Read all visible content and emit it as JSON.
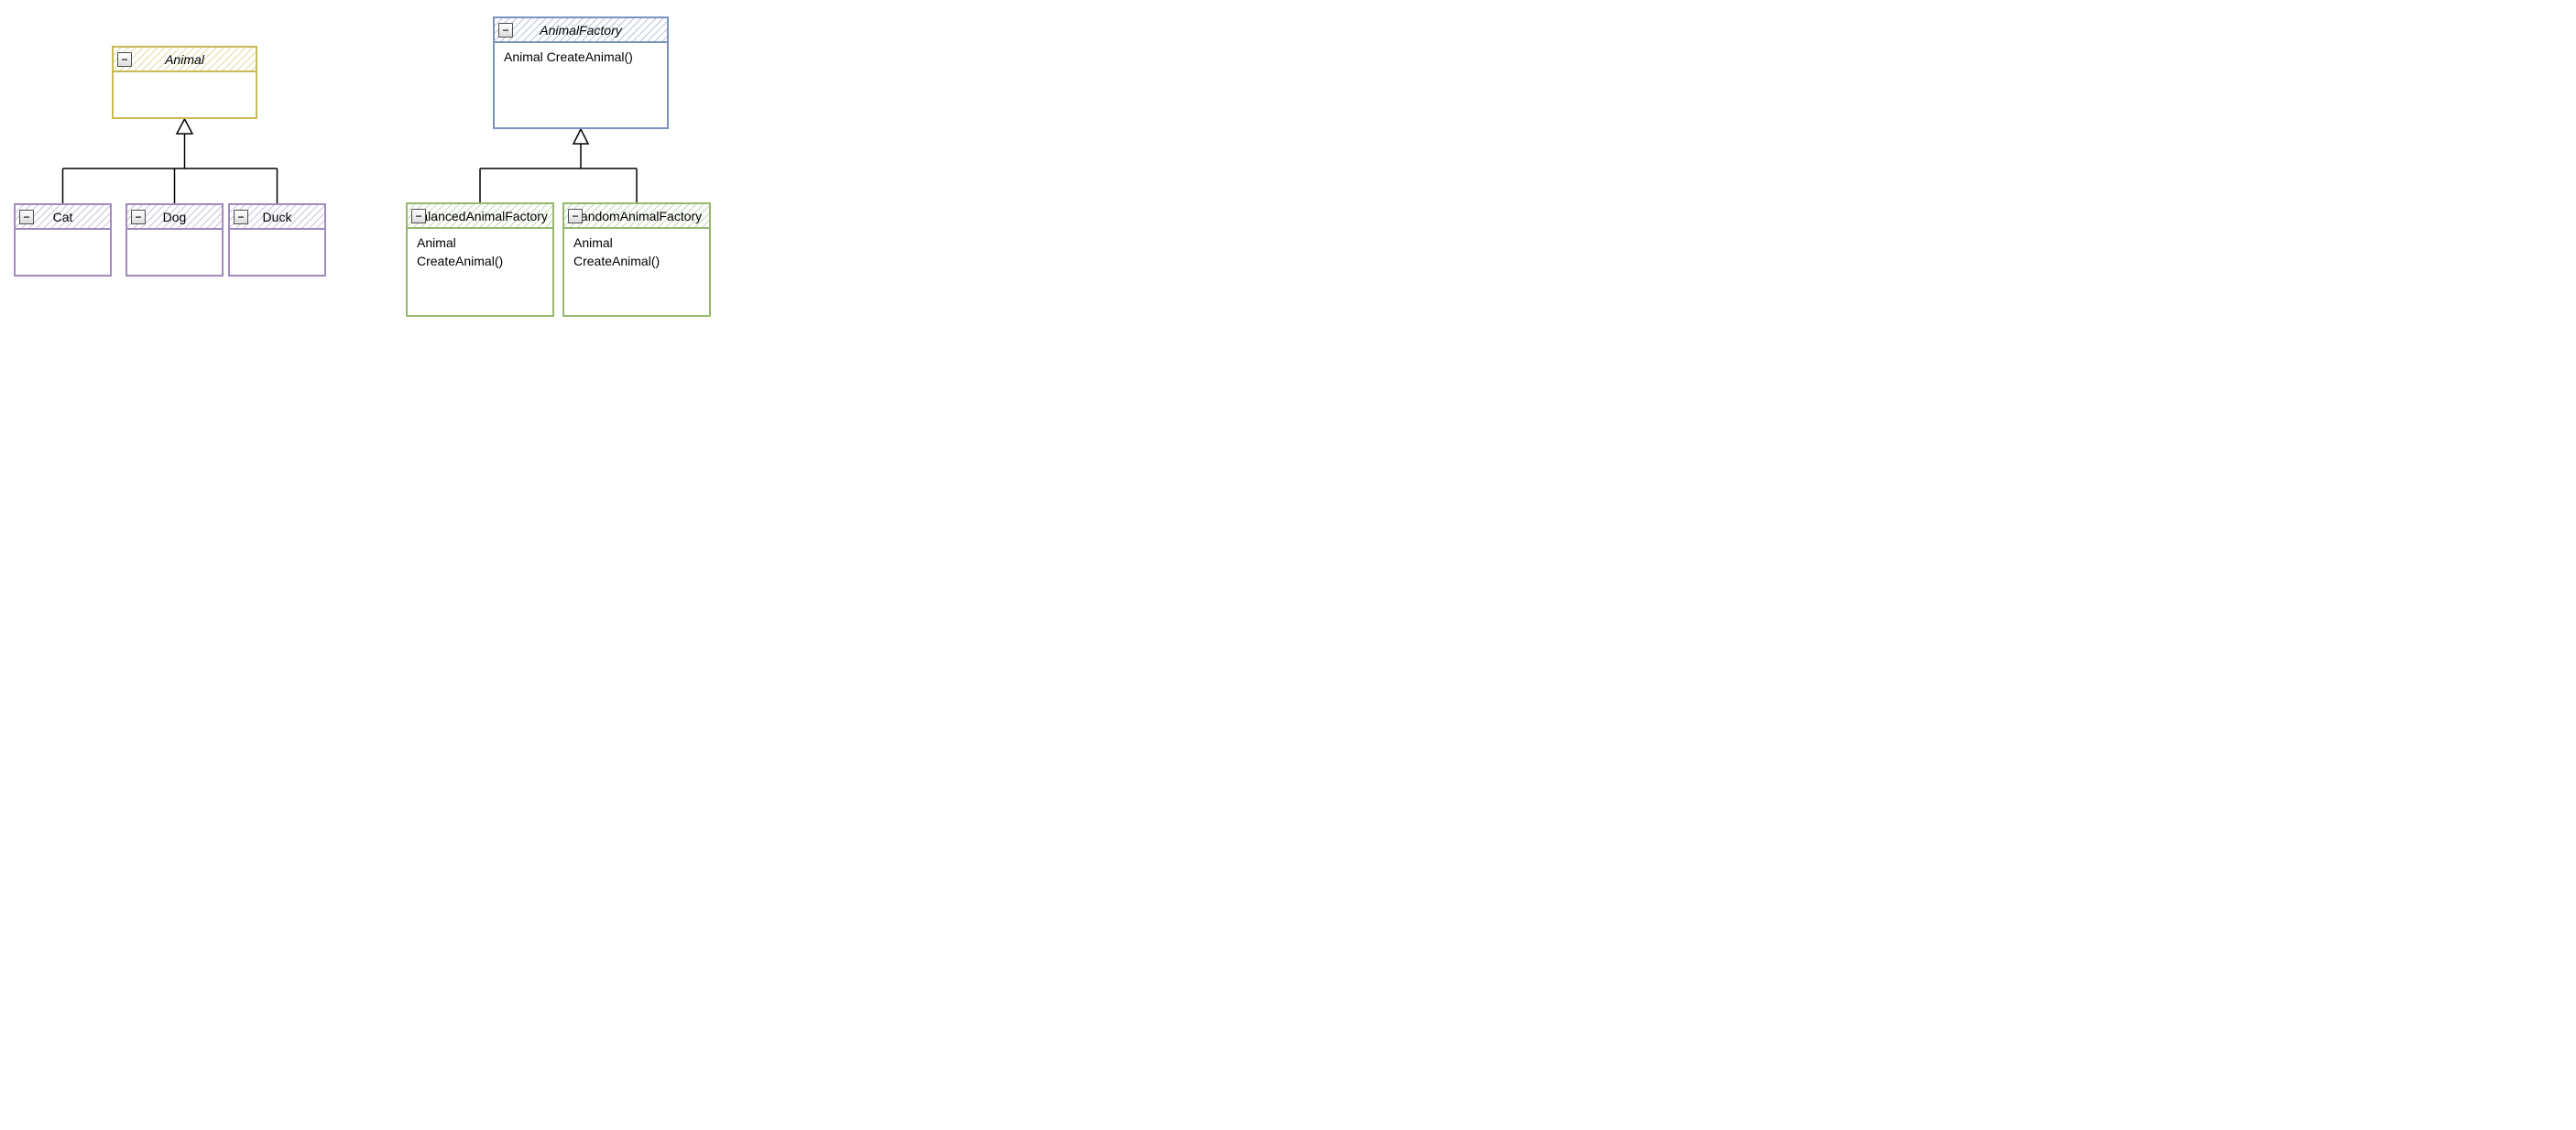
{
  "toggle_glyph": "−",
  "classes": {
    "animal": {
      "name": "Animal",
      "abstract": true,
      "methods": []
    },
    "cat": {
      "name": "Cat",
      "abstract": false,
      "methods": []
    },
    "dog": {
      "name": "Dog",
      "abstract": false,
      "methods": []
    },
    "duck": {
      "name": "Duck",
      "abstract": false,
      "methods": []
    },
    "animalfactory": {
      "name": "AnimalFactory",
      "abstract": true,
      "methods": [
        "Animal CreateAnimal()"
      ]
    },
    "balancedanimalfactory": {
      "name": "BalancedAnimalFactory",
      "abstract": false,
      "methods": [
        "Animal CreateAnimal()"
      ]
    },
    "randomanimalfactory": {
      "name": "RandomAnimalFactory",
      "abstract": false,
      "methods": [
        "Animal CreateAnimal()"
      ]
    }
  },
  "relations": [
    {
      "child": "cat",
      "parent": "animal",
      "type": "generalization"
    },
    {
      "child": "dog",
      "parent": "animal",
      "type": "generalization"
    },
    {
      "child": "duck",
      "parent": "animal",
      "type": "generalization"
    },
    {
      "child": "balancedanimalfactory",
      "parent": "animalfactory",
      "type": "generalization"
    },
    {
      "child": "randomanimalfactory",
      "parent": "animalfactory",
      "type": "generalization"
    }
  ],
  "colors": {
    "yellow": "#caba52",
    "purple": "#a08bbf",
    "blue": "#7a93bd",
    "green": "#95b86e",
    "connector": "#000000"
  }
}
